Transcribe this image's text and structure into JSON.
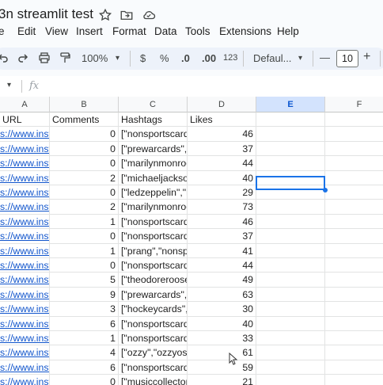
{
  "title": "3n streamlit test",
  "menu": [
    "e",
    "Edit",
    "View",
    "Insert",
    "Format",
    "Data",
    "Tools",
    "Extensions",
    "Help"
  ],
  "toolbar": {
    "zoom": "100%",
    "currency": "$",
    "percent": "%",
    "decrease_decimal": ".0",
    "increase_decimal": ".00",
    "number_format": "123",
    "font": "Defaul...",
    "font_size": "10",
    "minus": "—",
    "plus": "+"
  },
  "formula_bar": {
    "fx": "fx",
    "name_box_arrow": "▾"
  },
  "columns": [
    "A",
    "B",
    "C",
    "D",
    "E",
    "F"
  ],
  "selected_column": "E",
  "headers": [
    "URL",
    "Comments",
    "Hashtags",
    "Likes",
    "",
    ""
  ],
  "rows": [
    {
      "url": "s://www.insta",
      "comments": "0",
      "hashtags": "[\"nonsportscards",
      "likes": "46"
    },
    {
      "url": "s://www.insta",
      "comments": "0",
      "hashtags": "[\"prewarcards\",\"r",
      "likes": "37"
    },
    {
      "url": "s://www.insta",
      "comments": "0",
      "hashtags": "[\"marilynmonroe'",
      "likes": "44"
    },
    {
      "url": "s://www.insta",
      "comments": "2",
      "hashtags": "[\"michaeljackson",
      "likes": "40"
    },
    {
      "url": "s://www.insta",
      "comments": "0",
      "hashtags": "[\"ledzeppelin\",\"n",
      "likes": "29"
    },
    {
      "url": "s://www.insta",
      "comments": "2",
      "hashtags": "[\"marilynmonroe'",
      "likes": "73"
    },
    {
      "url": "s://www.insta",
      "comments": "1",
      "hashtags": "[\"nonsportscards",
      "likes": "46"
    },
    {
      "url": "s://www.insta",
      "comments": "0",
      "hashtags": "[\"nonsportscards",
      "likes": "37"
    },
    {
      "url": "s://www.insta",
      "comments": "1",
      "hashtags": "[\"prang\",\"nonspo",
      "likes": "41"
    },
    {
      "url": "s://www.insta",
      "comments": "0",
      "hashtags": "[\"nonsportscards",
      "likes": "44"
    },
    {
      "url": "s://www.insta",
      "comments": "5",
      "hashtags": "[\"theodoreroosev",
      "likes": "49"
    },
    {
      "url": "s://www.insta",
      "comments": "9",
      "hashtags": "[\"prewarcards\",\"r",
      "likes": "63"
    },
    {
      "url": "s://www.insta",
      "comments": "3",
      "hashtags": "[\"hockeycards\",\"|",
      "likes": "30"
    },
    {
      "url": "s://www.insta",
      "comments": "6",
      "hashtags": "[\"nonsportscards",
      "likes": "40"
    },
    {
      "url": "s://www.insta",
      "comments": "1",
      "hashtags": "[\"nonsportscards",
      "likes": "33"
    },
    {
      "url": "s://www.insta",
      "comments": "4",
      "hashtags": "[\"ozzy\",\"ozzyosb",
      "likes": "61"
    },
    {
      "url": "s://www.insta",
      "comments": "6",
      "hashtags": "[\"nonsportscards",
      "likes": "59"
    },
    {
      "url": "s://www.insta",
      "comments": "0",
      "hashtags": "[\"musiccollector\"",
      "likes": "21"
    }
  ],
  "colors": {
    "accent": "#1a73e8",
    "link": "#1155cc",
    "toolbar_bg": "#edf2fa",
    "selected_header_bg": "#d3e3fd"
  },
  "icons": [
    "star-icon",
    "move-to-folder-icon",
    "cloud-status-icon",
    "undo-icon",
    "redo-icon",
    "print-icon",
    "paint-format-icon",
    "zoom-dropdown-icon",
    "font-dropdown-icon"
  ]
}
